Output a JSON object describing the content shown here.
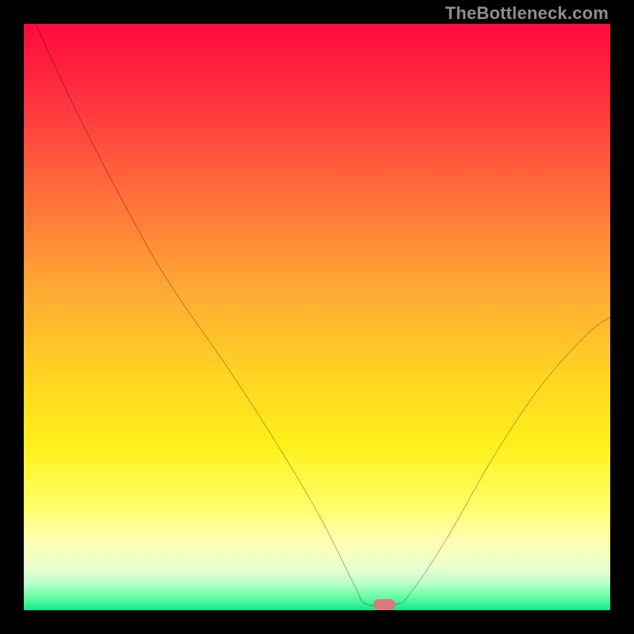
{
  "watermark": "TheBottleneck.com",
  "marker": {
    "x_pct": 61.5,
    "y_pct": 99.0
  },
  "colors": {
    "black": "#000000",
    "curve": "#000000",
    "marker": "#d87a7a",
    "watermark": "#8e8e8e"
  },
  "chart_data": {
    "type": "line",
    "title": "",
    "xlabel": "",
    "ylabel": "",
    "xlim": [
      0,
      100
    ],
    "ylim": [
      0,
      100
    ],
    "note": "Bottleneck curve on qualitative red→green background; minimum (optimal point) marked by pill",
    "background_gradient_stops": [
      {
        "pos": 0.0,
        "color": "#ff0a3c"
      },
      {
        "pos": 0.12,
        "color": "#ff2e40"
      },
      {
        "pos": 0.28,
        "color": "#ff6a3a"
      },
      {
        "pos": 0.45,
        "color": "#ffa834"
      },
      {
        "pos": 0.6,
        "color": "#ffd423"
      },
      {
        "pos": 0.72,
        "color": "#fff01a"
      },
      {
        "pos": 0.82,
        "color": "#ffff66"
      },
      {
        "pos": 0.88,
        "color": "#ffffb0"
      },
      {
        "pos": 0.93,
        "color": "#e8ffd0"
      },
      {
        "pos": 0.955,
        "color": "#b8ffc9"
      },
      {
        "pos": 0.975,
        "color": "#6effa8"
      },
      {
        "pos": 1.0,
        "color": "#14e888"
      }
    ],
    "series": [
      {
        "name": "bottleneck-curve",
        "points": [
          {
            "x": 2.0,
            "y": 100.0
          },
          {
            "x": 10.0,
            "y": 83.0
          },
          {
            "x": 20.0,
            "y": 64.0
          },
          {
            "x": 26.0,
            "y": 54.0
          },
          {
            "x": 35.0,
            "y": 41.0
          },
          {
            "x": 44.0,
            "y": 27.0
          },
          {
            "x": 51.0,
            "y": 15.0
          },
          {
            "x": 56.5,
            "y": 4.0
          },
          {
            "x": 58.5,
            "y": 1.0
          },
          {
            "x": 63.5,
            "y": 1.0
          },
          {
            "x": 66.0,
            "y": 3.0
          },
          {
            "x": 72.0,
            "y": 12.0
          },
          {
            "x": 80.0,
            "y": 26.0
          },
          {
            "x": 88.0,
            "y": 38.0
          },
          {
            "x": 96.0,
            "y": 47.0
          },
          {
            "x": 100.0,
            "y": 50.0
          }
        ]
      }
    ],
    "optimal_point": {
      "x": 61.5,
      "y": 1.0
    }
  }
}
